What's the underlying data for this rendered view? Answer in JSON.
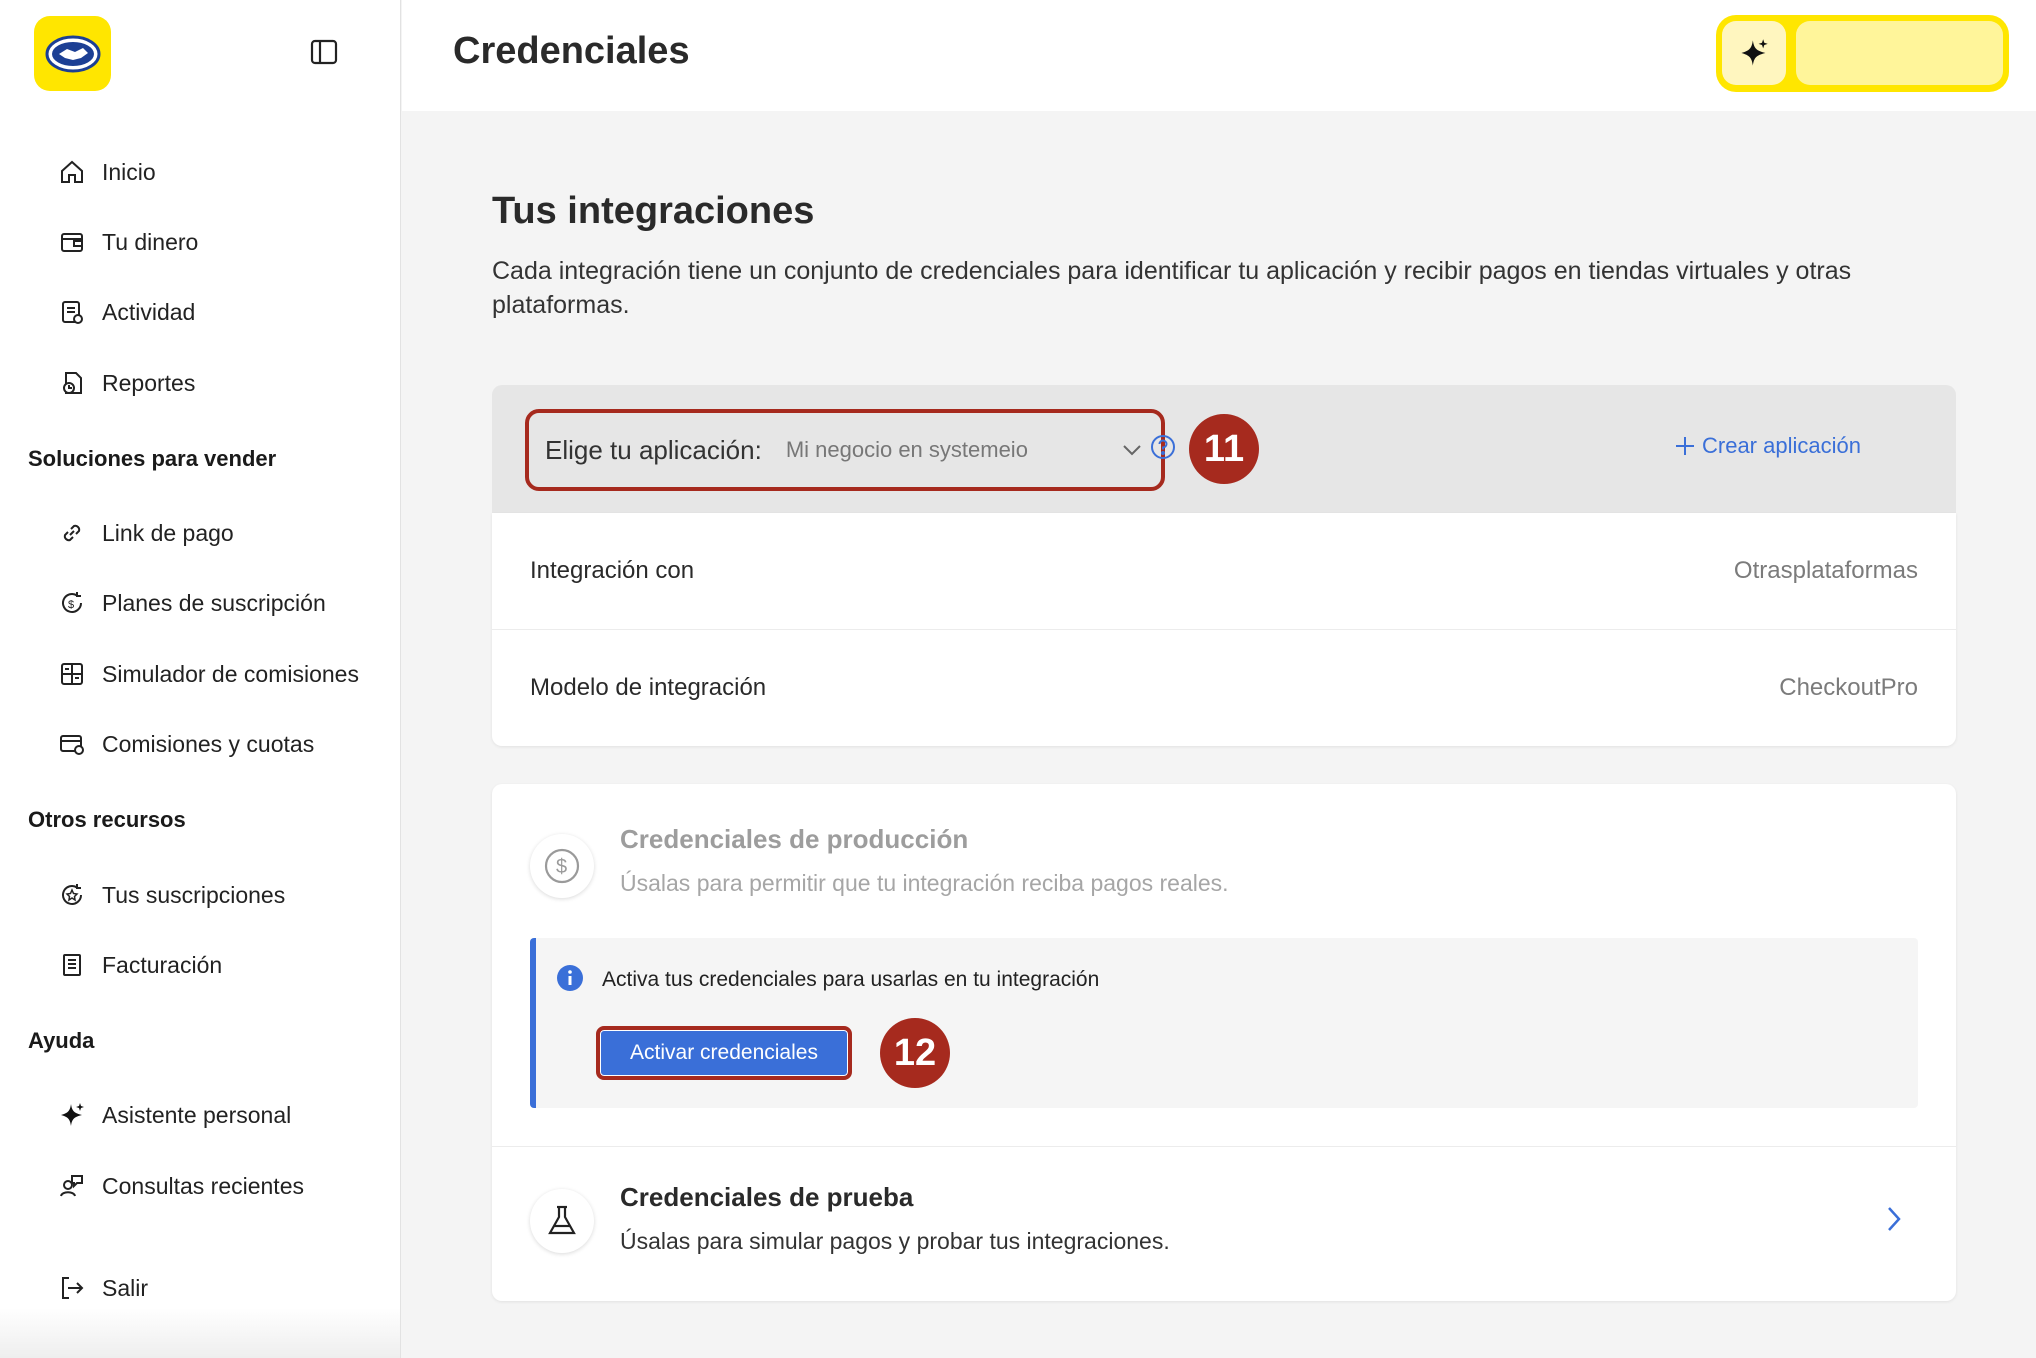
{
  "sidebar": {
    "items": {
      "inicio": "Inicio",
      "tu_dinero": "Tu dinero",
      "actividad": "Actividad",
      "reportes": "Reportes",
      "link_pago": "Link de pago",
      "planes": "Planes de suscripción",
      "simulador": "Simulador de comisiones",
      "comisiones": "Comisiones y cuotas",
      "tus_suscripciones": "Tus suscripciones",
      "facturacion": "Facturación",
      "asistente": "Asistente personal",
      "consultas": "Consultas recientes",
      "salir": "Salir"
    },
    "sections": {
      "vender": "Soluciones para vender",
      "otros": "Otros recursos",
      "ayuda": "Ayuda"
    }
  },
  "header": {
    "title": "Credenciales"
  },
  "main": {
    "title": "Tus integraciones",
    "description": "Cada integración tiene un conjunto de credenciales para identificar tu aplicación y recibir pagos en tiendas virtuales y otras plataformas.",
    "app_selector": {
      "label": "Elige tu aplicación:",
      "value": "Mi negocio en systemeio",
      "step": "11"
    },
    "create_app": "Crear aplicación",
    "info": {
      "integration_with_label": "Integración con",
      "integration_with_value": "Otrasplataformas",
      "model_label": "Modelo de integración",
      "model_value": "CheckoutPro"
    },
    "production": {
      "title": "Credenciales de producción",
      "subtitle": "Úsalas para permitir que tu integración reciba pagos reales.",
      "notice": "Activa tus credenciales para usarlas en tu integración",
      "button": "Activar credenciales",
      "step": "12"
    },
    "test": {
      "title": "Credenciales de prueba",
      "subtitle": "Úsalas para simular pagos y probar tus integraciones."
    }
  },
  "colors": {
    "brand_yellow": "#ffe600",
    "accent_blue": "#3a6fd8",
    "annotation_red": "#a62a1e"
  },
  "icons": {
    "logo": "handshake-icon",
    "collapse": "sidebar-toggle-icon",
    "assistant": "sparkle-icon",
    "help": "question-circle-icon",
    "info": "info-circle-icon",
    "production": "dollar-circle-icon",
    "test": "flask-icon",
    "next": "chevron-right-icon"
  }
}
